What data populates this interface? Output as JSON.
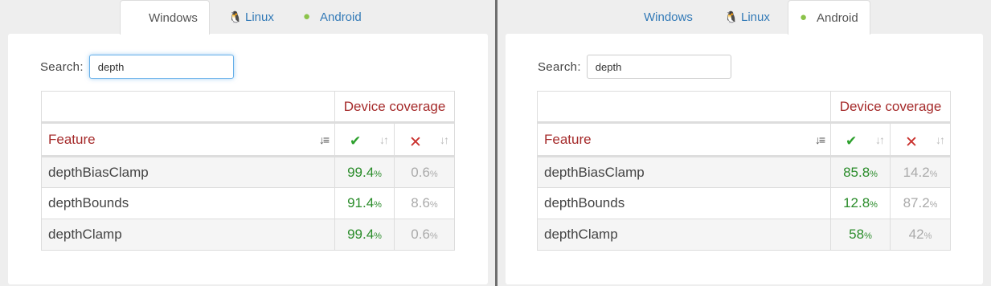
{
  "tabs": {
    "windows": "Windows",
    "linux": "Linux",
    "android": "Android"
  },
  "icons": {
    "windows": "windows-logo-icon",
    "linux": "linux-tux-icon",
    "android": "android-robot-icon",
    "sort": "sort-icon",
    "supported": "checkmark-icon",
    "unsupported": "cross-icon"
  },
  "colors": {
    "link": "#337ab7",
    "header_red": "#a52a2a",
    "supported_green": "#2a8c2a",
    "unsupported_gray": "#aaaaaa",
    "focus_blue": "#66afe9"
  },
  "search": {
    "label": "Search:"
  },
  "left": {
    "active_tab": "Windows",
    "search_value": "depth",
    "table": {
      "coverage_header": "Device coverage",
      "feature_header": "Feature",
      "rows": [
        {
          "feature": "depthBiasClamp",
          "supported": "99.4",
          "unsupported": "0.6"
        },
        {
          "feature": "depthBounds",
          "supported": "91.4",
          "unsupported": "8.6"
        },
        {
          "feature": "depthClamp",
          "supported": "99.4",
          "unsupported": "0.6"
        }
      ]
    }
  },
  "right": {
    "active_tab": "Android",
    "search_value": "depth",
    "table": {
      "coverage_header": "Device coverage",
      "feature_header": "Feature",
      "rows": [
        {
          "feature": "depthBiasClamp",
          "supported": "85.8",
          "unsupported": "14.2"
        },
        {
          "feature": "depthBounds",
          "supported": "12.8",
          "unsupported": "87.2"
        },
        {
          "feature": "depthClamp",
          "supported": "58",
          "unsupported": "42"
        }
      ]
    }
  },
  "percent_sign": "%"
}
